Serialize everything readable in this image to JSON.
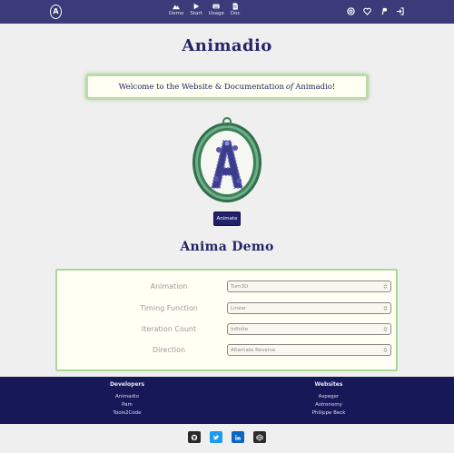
{
  "brand": {
    "logo_letter": "A"
  },
  "nav": {
    "links": [
      {
        "label": "Demo",
        "icon": "mountain-icon"
      },
      {
        "label": "Start",
        "icon": "play-icon"
      },
      {
        "label": "Usage",
        "icon": "keyboard-icon"
      },
      {
        "label": "Doc",
        "icon": "document-icon"
      }
    ],
    "right_icons": [
      "at-icon",
      "heart-icon",
      "paypal-icon",
      "sign-in-icon"
    ]
  },
  "page": {
    "title": "Animadio",
    "welcome_prefix": "Welcome to the Website & Documentation",
    "welcome_of": "of",
    "welcome_name": "Animadio!",
    "animate_button": "Animate"
  },
  "demo": {
    "title": "Anima Demo",
    "rows": [
      {
        "label": "Animation",
        "value": "Turn3D"
      },
      {
        "label": "Timing Function",
        "value": "Linear"
      },
      {
        "label": "Iteration Count",
        "value": "Infinite"
      },
      {
        "label": "Direction",
        "value": "Alternate Reverse"
      }
    ]
  },
  "footer": {
    "developers": {
      "heading": "Developers",
      "items": [
        "Animadio",
        "Pam",
        "Tools2Code"
      ]
    },
    "websites": {
      "heading": "Websites",
      "items": [
        "Aspeger",
        "Astronomy",
        "Philippe Beck"
      ]
    }
  },
  "social": [
    {
      "icon": "github-icon",
      "color": "#2b2b2b"
    },
    {
      "icon": "twitter-icon",
      "color": "#1d9bf0"
    },
    {
      "icon": "linkedin-icon",
      "color": "#0a66c2"
    },
    {
      "icon": "codepen-icon",
      "color": "#2b2b2b"
    }
  ],
  "colors": {
    "nav_bg": "#3a3b78",
    "footer_bg": "#171858",
    "accent_green": "#a9d898",
    "button_bg": "#20216a"
  }
}
